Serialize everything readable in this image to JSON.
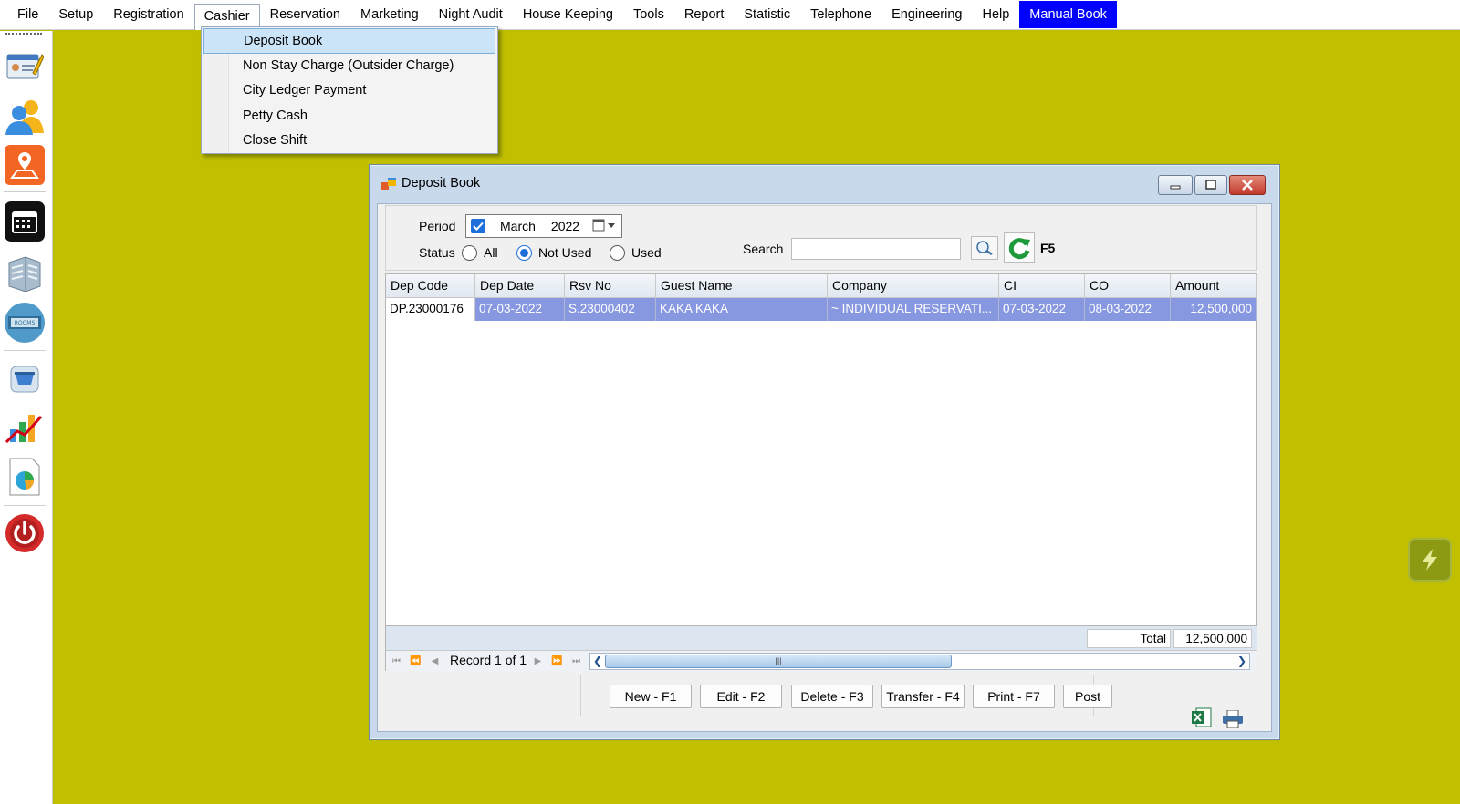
{
  "menubar": {
    "items": [
      "File",
      "Setup",
      "Registration",
      "Cashier",
      "Reservation",
      "Marketing",
      "Night Audit",
      "House Keeping",
      "Tools",
      "Report",
      "Statistic",
      "Telephone",
      "Engineering",
      "Help",
      "Manual Book"
    ],
    "open_item": "Cashier",
    "highlight_color": "#0000ff"
  },
  "cashier_menu": {
    "items": [
      "Deposit Book",
      "Non Stay Charge (Outsider Charge)",
      "City Ledger Payment",
      "Petty Cash",
      "Close Shift"
    ],
    "highlighted": "Deposit Book"
  },
  "toolbar": {
    "icons": [
      "guest-card-icon",
      "guests-icon",
      "location-icon",
      "calendar-icon",
      "building-icon",
      "rooms-available-icon",
      "cart-icon",
      "chart-icon",
      "pie-report-icon",
      "power-icon"
    ],
    "rooms_badge": "ROOMS"
  },
  "window": {
    "title": "Deposit Book",
    "filter": {
      "period_label": "Period",
      "period_checked": true,
      "period_month": "March",
      "period_year": "2022",
      "status_label": "Status",
      "status_options": [
        "All",
        "Not Used",
        "Used"
      ],
      "status_selected": "Not Used",
      "search_label": "Search",
      "search_value": "",
      "refresh_hint": "F5"
    },
    "grid": {
      "columns": [
        "Dep Code",
        "Dep Date",
        "Rsv No",
        "Guest Name",
        "Company",
        "CI",
        "CO",
        "Amount"
      ],
      "rows": [
        [
          "DP.23000176",
          "07-03-2022",
          "S.23000402",
          "KAKA KAKA",
          "~ INDIVIDUAL RESERVATI...",
          "07-03-2022",
          "08-03-2022",
          "12,500,000"
        ]
      ],
      "total_label": "Total",
      "total_value": "12,500,000",
      "record_text": "Record 1 of 1",
      "selection_color": "#8797e0"
    },
    "buttons": [
      "New - F1",
      "Edit - F2",
      "Delete - F3",
      "Transfer - F4",
      "Print - F7",
      "Post"
    ]
  },
  "colors": {
    "desktop": "#c0c000",
    "window_frame": "#c9d9ec"
  }
}
